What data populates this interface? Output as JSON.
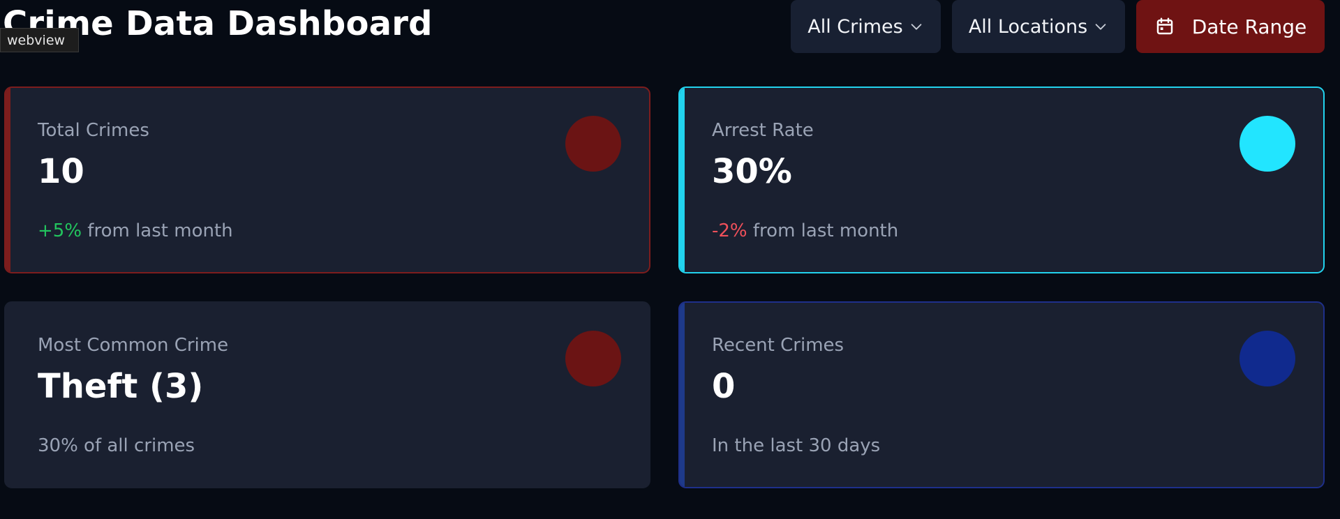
{
  "header": {
    "title": "Crime Data Dashboard",
    "webview_tag": "webview"
  },
  "filters": {
    "crime_type": "All Crimes",
    "location": "All Locations",
    "date_range_label": "Date Range"
  },
  "icons": {
    "dropdown": "chevron-down-icon",
    "date": "calendar-icon"
  },
  "colors": {
    "background": "#060b14",
    "card": "#1a2030",
    "red_accent": "#7d1d1d",
    "cyan_accent": "#22d3ee",
    "blue_accent": "#1e3a8a",
    "positive": "#22c55e",
    "negative": "#f0505a"
  },
  "cards": [
    {
      "label": "Total Crimes",
      "value": "10",
      "change": "+5%",
      "change_suffix": " from last month",
      "indicator_color": "#6b1414"
    },
    {
      "label": "Arrest Rate",
      "value": "30%",
      "change": "-2%",
      "change_suffix": " from last month",
      "indicator_color": "#22e5ff"
    },
    {
      "label": "Most Common Crime",
      "value": "Theft (3)",
      "subtitle": "30% of all crimes",
      "indicator_color": "#6b1414"
    },
    {
      "label": "Recent Crimes",
      "value": "0",
      "subtitle": "In the last 30 days",
      "indicator_color": "#102a8e"
    }
  ]
}
